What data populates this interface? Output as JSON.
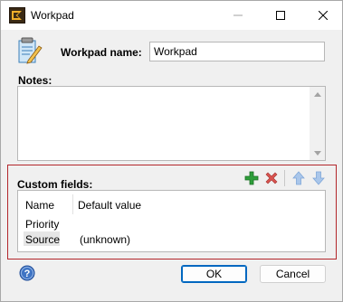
{
  "window": {
    "title": "Workpad",
    "icon": "workpad-app-icon",
    "controls": {
      "minimize_icon": "minimize-icon",
      "maximize_icon": "maximize-icon",
      "close_icon": "close-icon"
    }
  },
  "workpad": {
    "icon": "notepad-pencil-icon",
    "name_label": "Workpad name:",
    "name_value": "Workpad",
    "notes_label": "Notes:",
    "notes_value": ""
  },
  "custom_fields": {
    "label": "Custom fields:",
    "toolbar": {
      "add_icon": "add-icon",
      "delete_icon": "delete-icon",
      "move_up_icon": "arrow-up-icon",
      "move_down_icon": "arrow-down-icon"
    },
    "columns": [
      "Name",
      "Default value"
    ],
    "rows": [
      {
        "name": "Priority",
        "default": ""
      },
      {
        "name": "Source",
        "default": "(unknown)"
      }
    ]
  },
  "footer": {
    "help_icon": "help-icon",
    "ok_label": "OK",
    "cancel_label": "Cancel"
  },
  "colors": {
    "highlight_border": "#b3262b",
    "default_button_border": "#0067c0",
    "add_green": "#2e9e3a",
    "delete_red": "#d9534f",
    "arrow_blue": "#7fa7d9"
  }
}
